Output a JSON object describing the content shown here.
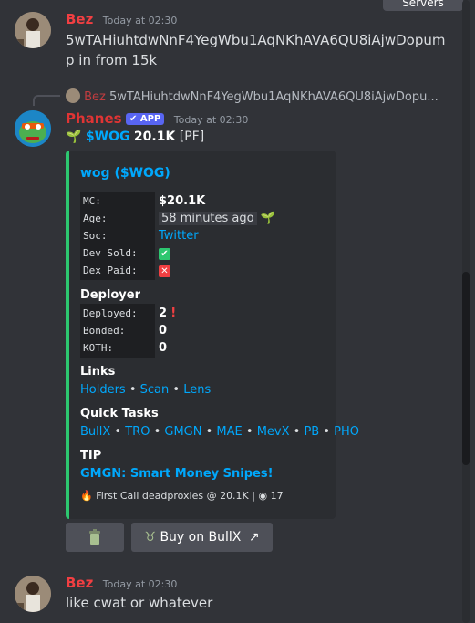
{
  "top_button": "Servers",
  "messages": [
    {
      "author": "Bez",
      "time": "Today at 02:30",
      "text_line1": "5wTAHiuhtdwNnF4YegWbu1AqNKhAVA6QU8iAjwDopum",
      "text_line2": "p in from 15k"
    },
    {
      "author": "Bez",
      "time": "Today at 02:30",
      "text": "like cwat or whatever"
    }
  ],
  "reply": {
    "author": "Bez",
    "text": "5wTAHiuhtdwNnF4YegWbu1AqNKhAVA6QU8iAjwDopu..."
  },
  "bot": {
    "author": "Phanes",
    "badge": "APP",
    "time": "Today at 02:30",
    "header_ticker": "$WOG",
    "header_value": "20.1K",
    "header_tag": "[PF]",
    "sprout_icon": "🌱"
  },
  "embed": {
    "accent_color": "#2dc770",
    "title": "wog ($WOG)",
    "stats": {
      "mc_label": "MC:",
      "mc_value": "$20.1K",
      "age_label": "Age:",
      "age_value": "58 minutes ago",
      "soc_label": "Soc:",
      "soc_value": "Twitter",
      "dev_sold_label": "Dev Sold:",
      "dev_paid_label": "Dex Paid:"
    },
    "deployer": {
      "title": "Deployer",
      "deployed_label": "Deployed:",
      "deployed_value": "2",
      "bonded_label": "Bonded:",
      "bonded_value": "0",
      "koth_label": "KOTH:",
      "koth_value": "0"
    },
    "links": {
      "title": "Links",
      "items": [
        "Holders",
        "Scan",
        "Lens"
      ]
    },
    "quick_tasks": {
      "title": "Quick Tasks",
      "items": [
        "BullX",
        "TRO",
        "GMGN",
        "MAE",
        "MevX",
        "PB",
        "PHO"
      ]
    },
    "tip": {
      "title": "TIP",
      "link": "GMGN: Smart Money Snipes!"
    },
    "footer": {
      "text": "First Call deadproxies @ 20.1K",
      "separator": "|",
      "views": "17"
    }
  },
  "buttons": {
    "trash_icon": "trash-icon",
    "bullx_label": "Buy on BullX"
  }
}
